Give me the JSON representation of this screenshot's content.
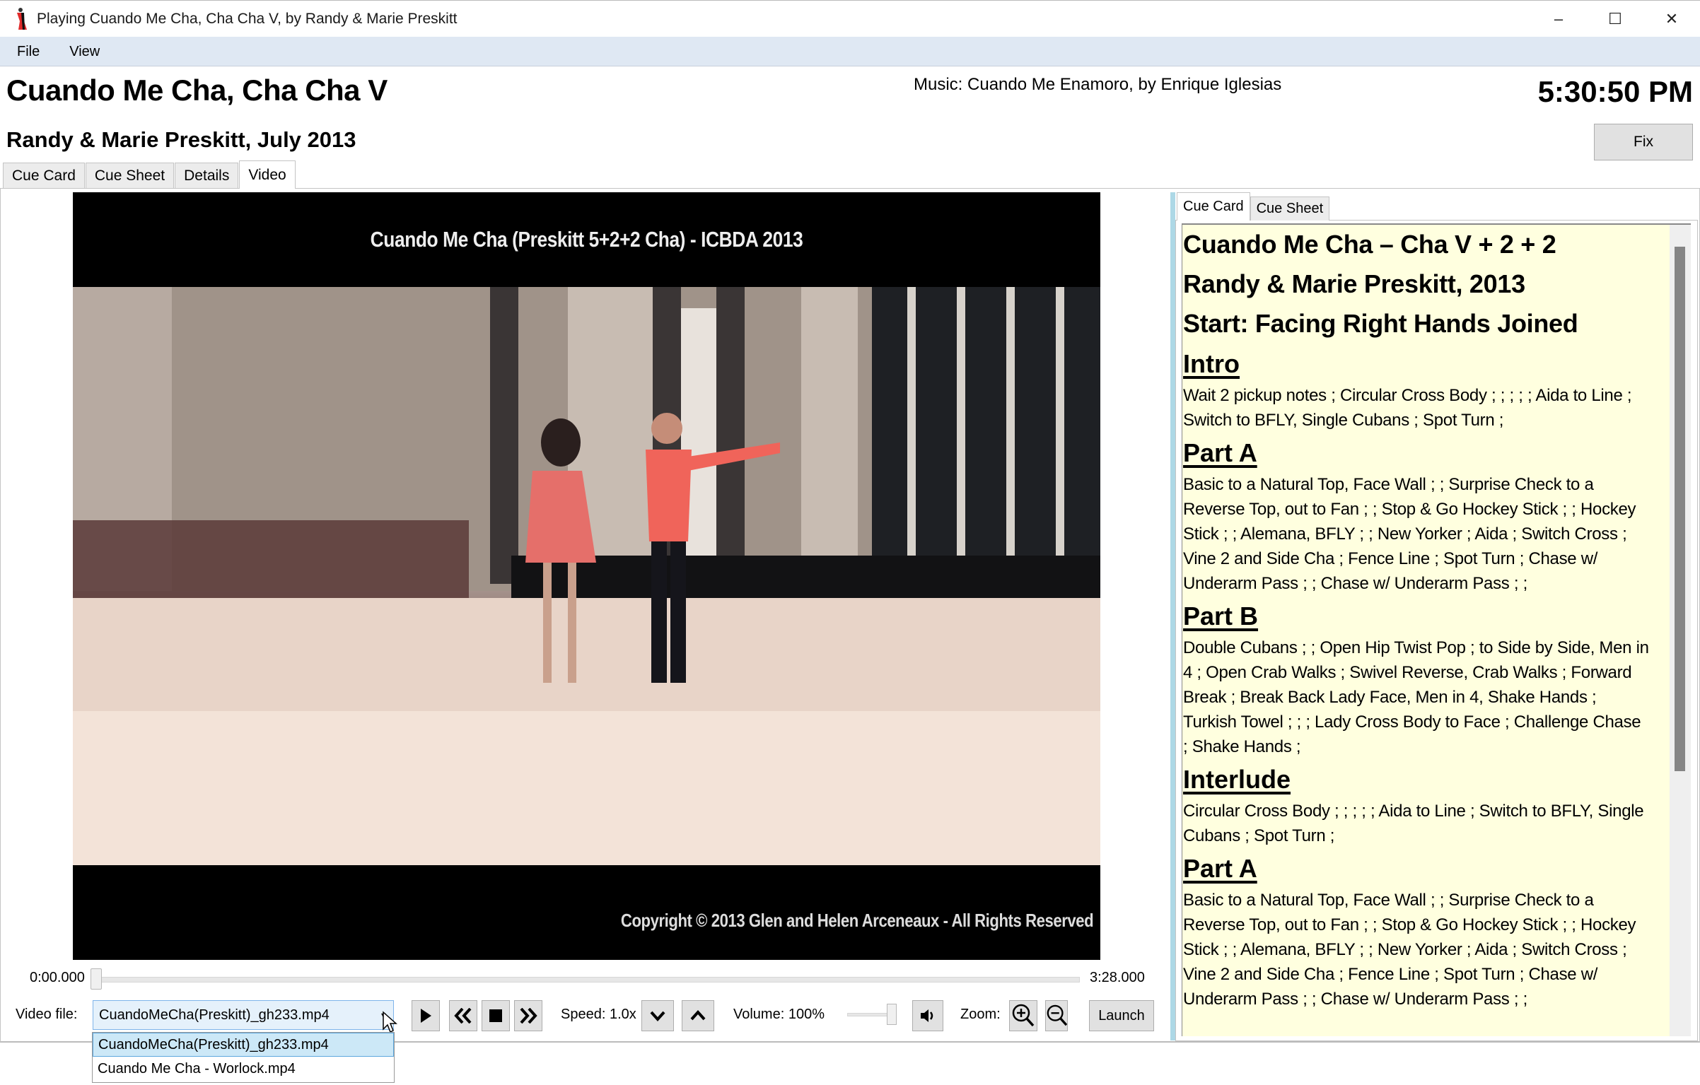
{
  "window": {
    "title": "Playing Cuando Me Cha, Cha Cha V, by Randy & Marie Preskitt",
    "controls": {
      "minimize": "–",
      "maximize": "☐",
      "close": "✕"
    }
  },
  "menu": [
    "File",
    "View"
  ],
  "header": {
    "dance_title": "Cuando Me Cha, Cha Cha V",
    "subtitle": "Randy & Marie Preskitt, July 2013",
    "music": "Music: Cuando Me Enamoro, by Enrique Iglesias",
    "clock": "5:30:50 PM",
    "fix_label": "Fix"
  },
  "main_tabs": [
    {
      "label": "Cue Card",
      "active": false
    },
    {
      "label": "Cue Sheet",
      "active": false
    },
    {
      "label": "Details",
      "active": false
    },
    {
      "label": "Video",
      "active": true
    }
  ],
  "video": {
    "caption_top": "Cuando Me Cha (Preskitt 5+2+2 Cha) - ICBDA 2013",
    "caption_bottom": "Copyright © 2013 Glen and Helen Arceneaux - All Rights Reserved",
    "time_start": "0:00.000",
    "time_end": "3:28.000",
    "progress_fraction": 0.0
  },
  "controls": {
    "video_file_label": "Video file:",
    "video_file_value": "CuandoMeCha(Preskitt)_gh233.mp4",
    "video_file_options": [
      {
        "label": "CuandoMeCha(Preskitt)_gh233.mp4",
        "selected": true
      },
      {
        "label": "Cuando Me Cha - Worlock.mp4",
        "selected": false
      }
    ],
    "speed_label": "Speed: 1.0x",
    "volume_label": "Volume: 100%",
    "volume_fraction": 1.0,
    "zoom_label": "Zoom:",
    "launch_label": "Launch",
    "icons": [
      "play-icon",
      "rewind-icon",
      "stop-icon",
      "fast-forward-icon",
      "speed-down-icon",
      "speed-up-icon",
      "speaker-icon",
      "zoom-in-icon",
      "zoom-out-icon"
    ]
  },
  "right_tabs": [
    {
      "label": "Cue Card",
      "active": true
    },
    {
      "label": "Cue Sheet",
      "active": false
    }
  ],
  "cue_card": {
    "heading_lines": [
      "Cuando Me Cha – Cha V + 2 + 2",
      "Randy & Marie Preskitt, 2013",
      "Start: Facing Right Hands Joined"
    ],
    "sections": [
      {
        "title": "Intro",
        "text": "Wait 2 pickup notes ; Circular Cross Body ; ; ; ; ; Aida to Line ; Switch to BFLY, Single Cubans ; Spot Turn ;"
      },
      {
        "title": "Part A",
        "text": "Basic to a Natural Top, Face Wall ; ; Surprise Check to a Reverse Top, out to Fan ; ; Stop & Go Hockey Stick ; ; Hockey Stick ; ; Alemana, BFLY ; ; New Yorker ; Aida ; Switch Cross ; Vine 2 and Side Cha ; Fence Line ; Spot Turn ; Chase w/ Underarm Pass ; ; Chase w/ Underarm Pass ; ;"
      },
      {
        "title": "Part B",
        "text": "Double Cubans ; ; Open Hip Twist Pop ; to Side by Side, Men in 4 ; Open Crab Walks ; Swivel Reverse, Crab Walks ; Forward Break ; Break Back Lady Face, Men in 4, Shake Hands ; Turkish Towel ; ; ; Lady Cross Body to Face ; Challenge Chase ; Shake Hands ;"
      },
      {
        "title": "Interlude",
        "text": "Circular Cross Body ; ; ; ; ; Aida to Line ; Switch to BFLY, Single Cubans ; Spot Turn ;"
      },
      {
        "title": "Part A",
        "text": "Basic to a Natural Top, Face Wall ; ; Surprise Check to a Reverse Top, out to Fan ; ; Stop & Go Hockey Stick ; ; Hockey Stick ; ; Alemana, BFLY ; ; New Yorker ; Aida ; Switch Cross ; Vine 2 and Side Cha ; Fence Line ; Spot Turn ; Chase w/ Underarm Pass ; ; Chase w/ Underarm Pass ; ;"
      }
    ]
  },
  "colors": {
    "menubar_bg": "#dfe8f3",
    "cue_card_bg": "#ffffdf",
    "splitter": "#add8e6",
    "combo_bg": "#e5f1fb",
    "combo_border": "#7eb4ea",
    "dropdown_selected": "#cce8f7"
  }
}
